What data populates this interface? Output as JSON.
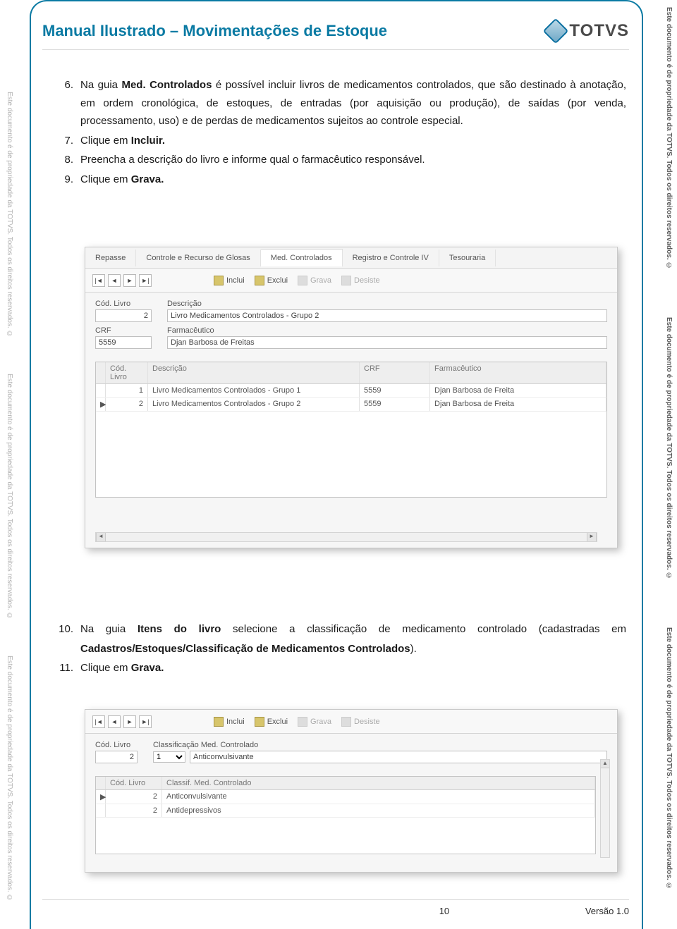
{
  "header": {
    "title": "Manual Ilustrado – Movimentações de Estoque",
    "logo_text": "TOTVS"
  },
  "watermark": "Este documento é de propriedade da TOTVS. Todos os direitos reservados. ©",
  "list1": [
    {
      "num": "6.",
      "html": "Na guia <b>Med. Controlados</b> é possível incluir livros de medicamentos controlados, que são destinado à anotação, em ordem cronológica, de estoques, de entradas (por aquisição ou produção), de saídas (por venda, processamento, uso) e de perdas de medicamentos sujeitos ao controle especial."
    },
    {
      "num": "7.",
      "html": "Clique em <b>Incluir.</b>"
    },
    {
      "num": "8.",
      "html": "Preencha a descrição do livro e informe qual o farmacêutico responsável."
    },
    {
      "num": "9.",
      "html": "Clique em <b>Grava.</b>"
    }
  ],
  "screenshot1": {
    "tabs": [
      "Repasse",
      "Controle e Recurso de Glosas",
      "Med. Controlados",
      "Registro e Controle IV",
      "Tesouraria"
    ],
    "active_tab_index": 2,
    "toolbar": {
      "inclui": "Inclui",
      "exclui": "Exclui",
      "grava": "Grava",
      "desiste": "Desiste"
    },
    "form": {
      "cod_livro_label": "Cód. Livro",
      "cod_livro_value": "2",
      "descricao_label": "Descrição",
      "descricao_value": "Livro Medicamentos Controlados - Grupo 2",
      "crf_label": "CRF",
      "crf_value": "5559",
      "farmaceutico_label": "Farmacêutico",
      "farmaceutico_value": "Djan Barbosa de Freitas"
    },
    "grid": {
      "headers": [
        "Cód. Livro",
        "Descrição",
        "CRF",
        "Farmacêutico"
      ],
      "rows": [
        {
          "cod": "1",
          "desc": "Livro Medicamentos Controlados - Grupo 1",
          "crf": "5559",
          "farm": "Djan Barbosa de Freita"
        },
        {
          "cod": "2",
          "desc": "Livro Medicamentos Controlados - Grupo 2",
          "crf": "5559",
          "farm": "Djan Barbosa de Freita"
        }
      ]
    }
  },
  "list2": [
    {
      "num": "10.",
      "html_spread": "Na guia <b>Itens do livro</b> selecione a classificação de medicamento controlado (cadastradas em",
      "html_rest": "<b>Cadastros/Estoques/Classificação de Medicamentos Controlados</b>)."
    },
    {
      "num": "11.",
      "html": "Clique em <b>Grava.</b>"
    }
  ],
  "screenshot2": {
    "toolbar": {
      "inclui": "Inclui",
      "exclui": "Exclui",
      "grava": "Grava",
      "desiste": "Desiste"
    },
    "form": {
      "cod_livro_label": "Cód. Livro",
      "cod_livro_value": "2",
      "classif_label": "Classificação Med. Controlado",
      "classif_select_value": "1",
      "classif_text": "Anticonvulsivante"
    },
    "grid": {
      "headers": [
        "Cód. Livro",
        "Classif. Med. Controlado"
      ],
      "rows": [
        {
          "cod": "2",
          "classif": "Anticonvulsivante"
        },
        {
          "cod": "2",
          "classif": "Antidepressivos"
        }
      ]
    }
  },
  "footer": {
    "page": "10",
    "version": "Versão 1.0"
  }
}
